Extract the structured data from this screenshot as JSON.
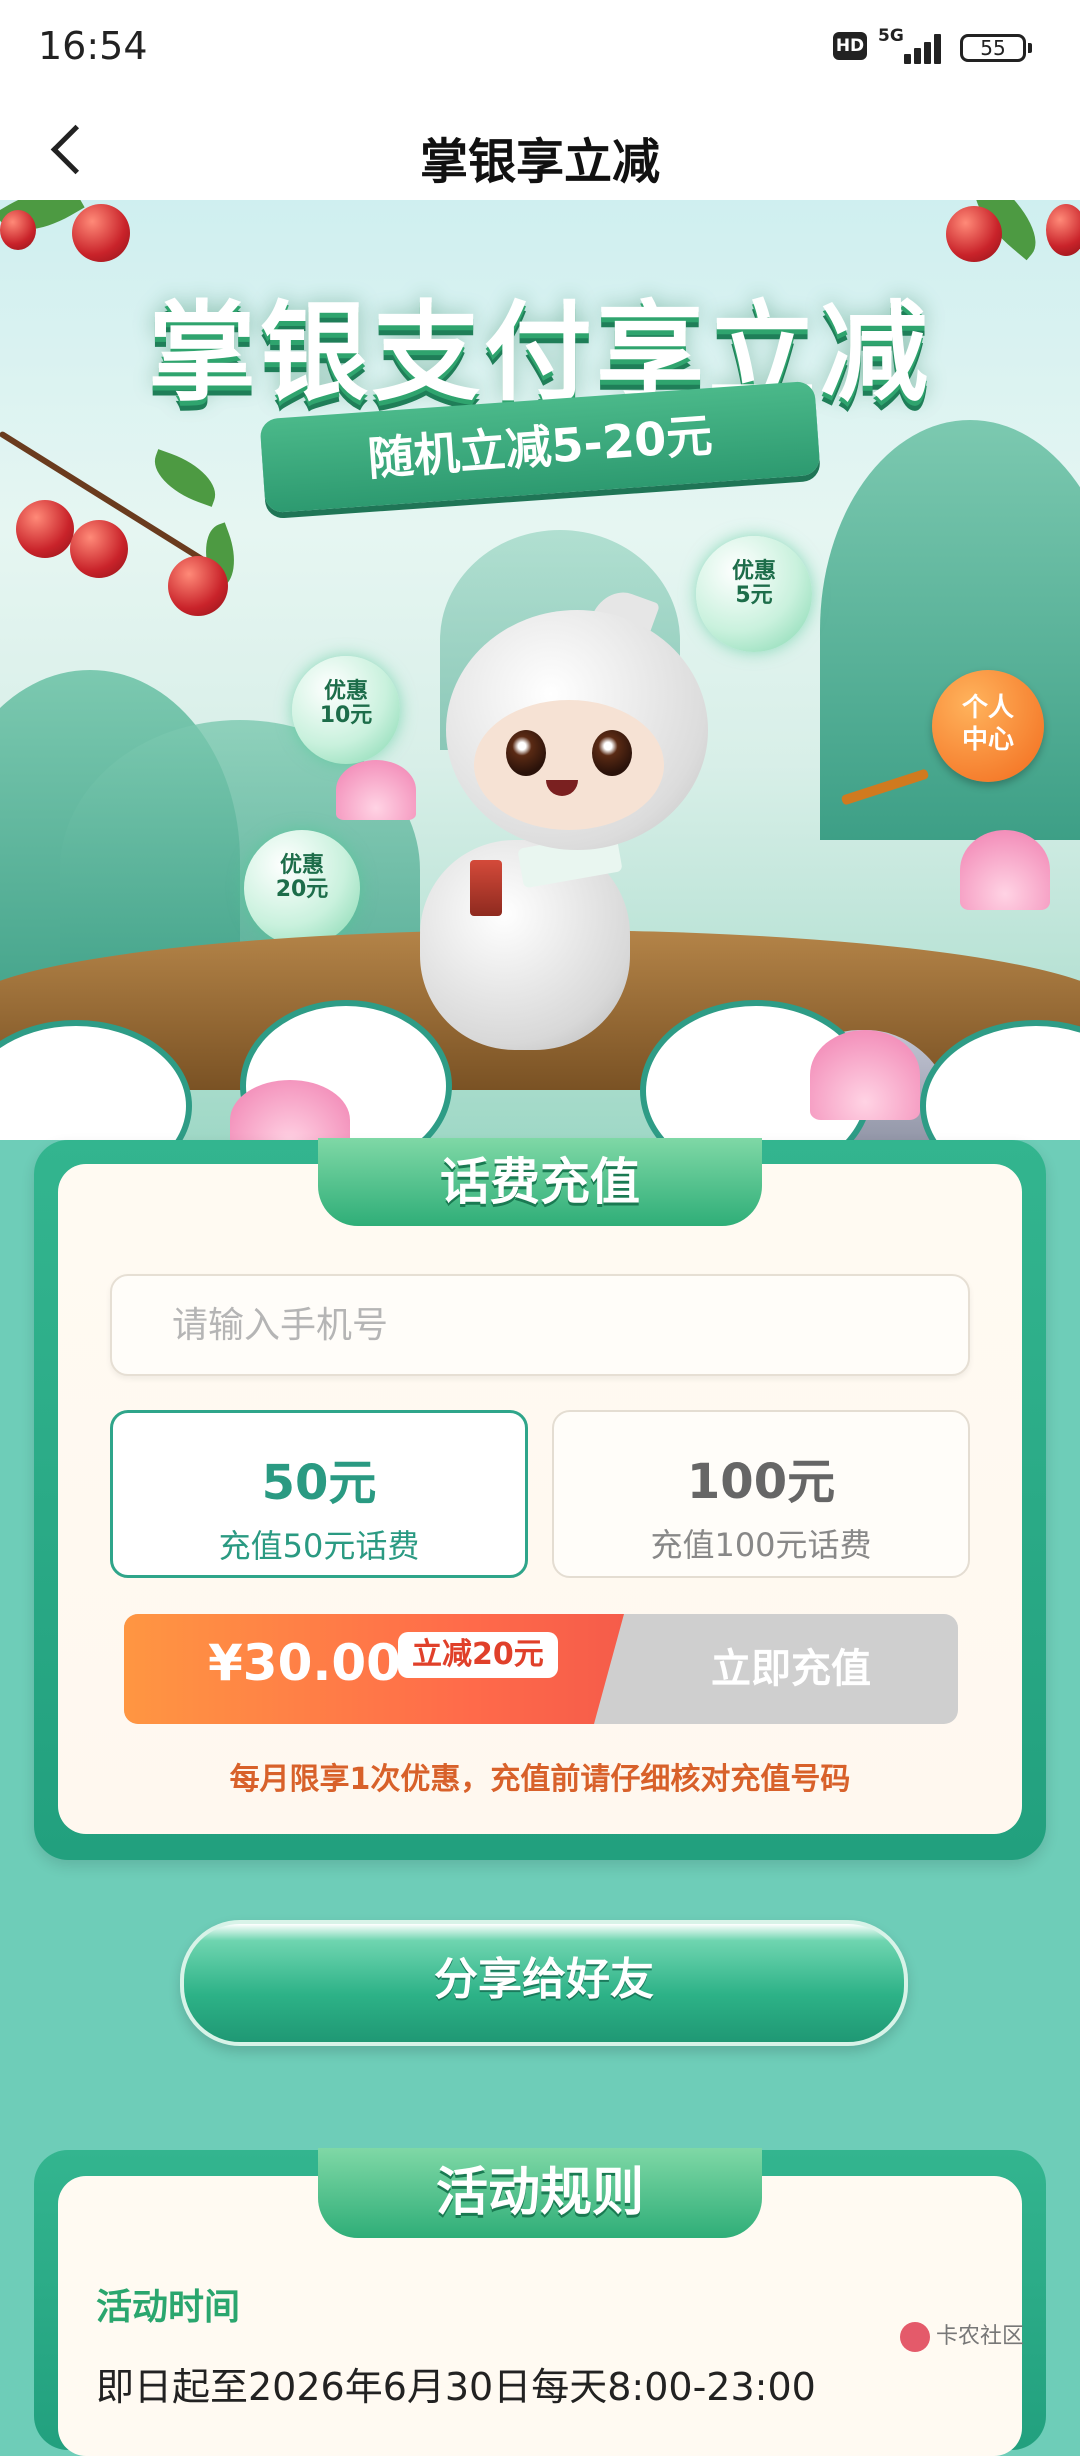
{
  "status_bar": {
    "time": "16:54",
    "hd": "HD",
    "network": "5G",
    "battery": "55"
  },
  "nav": {
    "title": "掌银享立减"
  },
  "banner": {
    "title": "掌银支付享立减",
    "subtitle": "随机立减5-20元",
    "bubbles": [
      {
        "line1": "优惠",
        "line2": "5元"
      },
      {
        "line1": "优惠",
        "line2": "10元"
      },
      {
        "line1": "优惠",
        "line2": "20元"
      }
    ],
    "personal_center": {
      "line1": "个人",
      "line2": "中心"
    }
  },
  "recharge": {
    "section_title": "话费充值",
    "phone_placeholder": "请输入手机号",
    "phone_value": "",
    "options": [
      {
        "amount": "50元",
        "desc": "充值50元话费",
        "selected": true
      },
      {
        "amount": "100元",
        "desc": "充值100元话费",
        "selected": false
      }
    ],
    "price": "¥30.00",
    "discount_tag": "立减20元",
    "pay_button": "立即充值",
    "notice": "每月限享1次优惠，充值前请仔细核对充值号码"
  },
  "share_button": "分享给好友",
  "rules": {
    "section_title": "活动规则",
    "time_label": "活动时间",
    "time_text": "即日起至2026年6月30日每天8:00-23:00"
  },
  "watermark": "卡农社区",
  "colors": {
    "accent": "#2fa58a",
    "orange": "#ff7a3d",
    "card_green": "#2aa883"
  }
}
